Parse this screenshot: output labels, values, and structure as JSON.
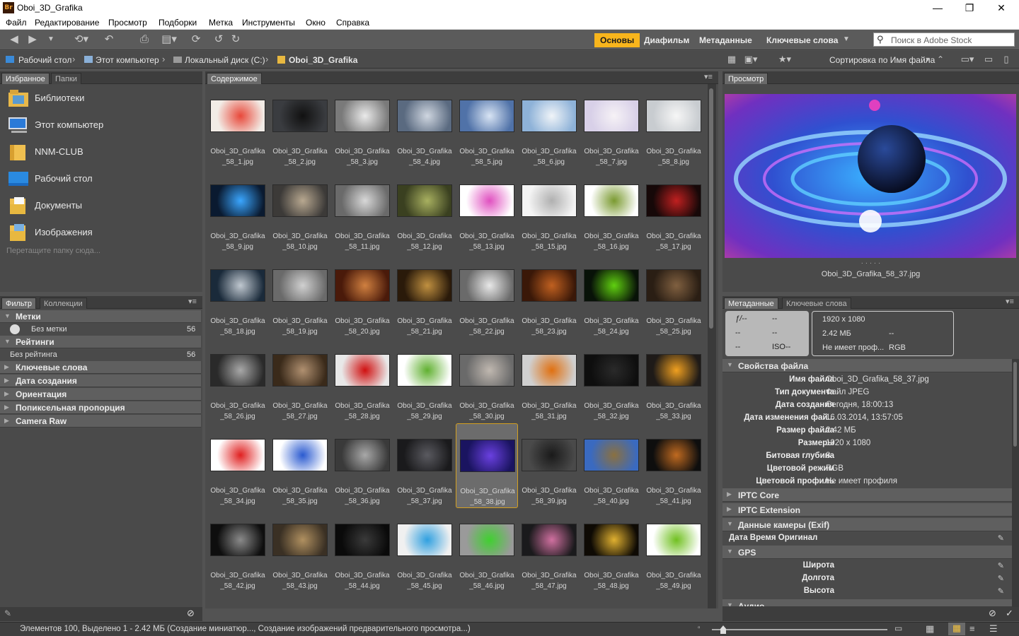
{
  "window": {
    "title": "Oboi_3D_Grafika",
    "app_badge": "Br",
    "min_glyph": "—",
    "max_glyph": "❐",
    "close_glyph": "✕"
  },
  "menu": [
    "Файл",
    "Редактирование",
    "Просмотр",
    "Подборки",
    "Метка",
    "Инструменты",
    "Окно",
    "Справка"
  ],
  "workspaces": [
    "Основы",
    "Диафильм",
    "Метаданные",
    "Ключевые слова"
  ],
  "search": {
    "placeholder": "Поиск в Adobe Stock"
  },
  "breadcrumb": [
    "Рабочий стол",
    "Этот компьютер",
    "Локальный диск (C:)",
    "Oboi_3D_Grafika"
  ],
  "sort_label": "Сортировка по Имя файла",
  "left_tabs": [
    "Избранное",
    "Папки"
  ],
  "favorites": [
    "Библиотеки",
    "Этот компьютер",
    "NNM-CLUB",
    "Рабочий стол",
    "Документы",
    "Изображения"
  ],
  "drop_hint": "Перетащите папку сюда...",
  "filter_tabs": [
    "Фильтр",
    "Коллекции"
  ],
  "filter": {
    "labels_group": "Метки",
    "no_label": "Без метки",
    "no_label_count": "56",
    "ratings_group": "Рейтинги",
    "no_rating": "Без рейтинга",
    "no_rating_count": "56",
    "groups": [
      "Ключевые слова",
      "Дата создания",
      "Ориентация",
      "Попиксельная пропорция",
      "Camera Raw"
    ]
  },
  "content_tab": "Содержимое",
  "selected_index": 36,
  "thumb_colors": [
    [
      "#f2ece6",
      "#e8483a"
    ],
    [
      "#3a3c40",
      "#111"
    ],
    [
      "#7a7a7a",
      "#eaeaea"
    ],
    [
      "#5a6a80",
      "#cfd6e0"
    ],
    [
      "#5072a8",
      "#d8e4f4"
    ],
    [
      "#8eb2d8",
      "#f0f4f8"
    ],
    [
      "#d8d0e8",
      "#f6f2f6"
    ],
    [
      "#c8ccd0",
      "#f6f6f6"
    ],
    [
      "#0a1a30",
      "#3aa6ff"
    ],
    [
      "#3c3a38",
      "#b8a890"
    ],
    [
      "#6a6a6a",
      "#d8d8d8"
    ],
    [
      "#3a4020",
      "#a8b060"
    ],
    [
      "#ffffff",
      "#e050c0"
    ],
    [
      "#f4f4f4",
      "#b0b0b0"
    ],
    [
      "#ffffff",
      "#7a9a30"
    ],
    [
      "#160808",
      "#c02020"
    ],
    [
      "#1a2a3a",
      "#c0c8d0"
    ],
    [
      "#6a6a6a",
      "#d0d0d0"
    ],
    [
      "#4a1a0a",
      "#d08040"
    ],
    [
      "#2a1a0a",
      "#c09040"
    ],
    [
      "#6a6a6a",
      "#e8e8e8"
    ],
    [
      "#3a1808",
      "#c06020"
    ],
    [
      "#081208",
      "#60d010"
    ],
    [
      "#2a1e14",
      "#806040"
    ],
    [
      "#2a2a2a",
      "#a8a8a8"
    ],
    [
      "#3a2a1a",
      "#b09070"
    ],
    [
      "#e8e8e8",
      "#d01010"
    ],
    [
      "#ffffff",
      "#60b030"
    ],
    [
      "#6a6a6a",
      "#c0b8b0"
    ],
    [
      "#d0d0d0",
      "#e07010"
    ],
    [
      "#0e0e0e",
      "#2a2a2a"
    ],
    [
      "#1e1a18",
      "#f0a020"
    ],
    [
      "#ffffff",
      "#e02020"
    ],
    [
      "#ffffff",
      "#2a5ad0"
    ],
    [
      "#3a3a3a",
      "#a8a8a8"
    ],
    [
      "#1a1a1c",
      "#5a5a60"
    ],
    [
      "#1a1460",
      "#6a40e0"
    ],
    [
      "#4a4a4a",
      "#1a1a1a"
    ],
    [
      "#3a6ac0",
      "#8a7040"
    ],
    [
      "#0e0e0e",
      "#c06a20"
    ],
    [
      "#0e0e0e",
      "#8a8a8a"
    ],
    [
      "#3a3024",
      "#b09060"
    ],
    [
      "#0a0a0a",
      "#3a3a3a"
    ],
    [
      "#f0f0f0",
      "#30a0e0"
    ],
    [
      "#9a9a9a",
      "#40d030"
    ],
    [
      "#1a1a1c",
      "#d070a0"
    ],
    [
      "#0e0a04",
      "#e0b030"
    ],
    [
      "#ffffff",
      "#70c020"
    ]
  ],
  "preview_tab": "Просмотр",
  "preview_caption": "Oboi_3D_Grafika_58_37.jpg",
  "preview_dots": "· · · · ·",
  "metadata_tabs": [
    "Метаданные",
    "Ключевые слова"
  ],
  "camera_box": {
    "aperture": "ƒ/--",
    "shutter": "--",
    "a": "--",
    "b": "--",
    "c": "--",
    "iso": "ISO--"
  },
  "image_box": {
    "dims": "1920 x 1080",
    "size": "2.42 МБ",
    "dash": "--",
    "profile": "Не имеет проф...",
    "mode": "RGB"
  },
  "file_props": {
    "title": "Свойства файла",
    "rows": [
      [
        "Имя файла",
        "Oboi_3D_Grafika_58_37.jpg"
      ],
      [
        "Тип документа",
        "Файл JPEG"
      ],
      [
        "Дата создания",
        "Сегодня, 18:00:13"
      ],
      [
        "Дата изменения фай...",
        "16.03.2014, 13:57:05"
      ],
      [
        "Размер файла",
        "2.42 МБ"
      ],
      [
        "Размеры",
        "1920 x 1080"
      ],
      [
        "Битовая глубина",
        "8"
      ],
      [
        "Цветовой режим",
        "RGB"
      ],
      [
        "Цветовой профиль",
        "Не имеет профиля"
      ]
    ]
  },
  "md_sections": [
    "IPTC Core",
    "IPTC Extension",
    "Данные камеры (Exif)"
  ],
  "exif_row": "Дата Время Оригинал",
  "gps_section": "GPS",
  "gps_rows": [
    "Широта",
    "Долгота",
    "Высота"
  ],
  "audio_section": "Аудио",
  "status_text": "Элементов 100, Выделено 1 - 2.42 МБ (Создание миниатюр..., Создание изображений предварительного просмотра...)",
  "colors": {
    "accent": "#f8b51c",
    "panel": "#4a4a4a",
    "header": "#3d3d3d"
  }
}
